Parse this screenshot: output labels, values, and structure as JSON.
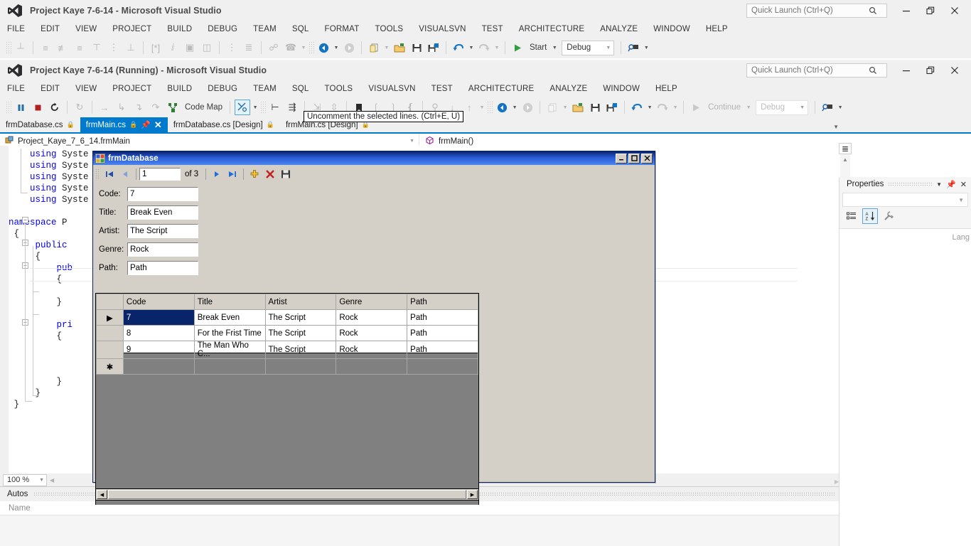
{
  "outer_window": {
    "title": "Project Kaye 7-6-14 - Microsoft Visual Studio",
    "logo_icon": "visual-studio-logo-icon",
    "quick_launch": {
      "placeholder": "Quick Launch (Ctrl+Q)",
      "value": "",
      "icon": "search-icon"
    },
    "window_buttons": {
      "minimize": "—",
      "restore": "❐",
      "close": "✕"
    },
    "menu": [
      "FILE",
      "EDIT",
      "VIEW",
      "PROJECT",
      "BUILD",
      "DEBUG",
      "TEAM",
      "SQL",
      "FORMAT",
      "TOOLS",
      "VISUALSVN",
      "TEST",
      "ARCHITECTURE",
      "ANALYZE",
      "WINDOW",
      "HELP"
    ],
    "toolbar": {
      "start_label": "Start",
      "config_value": "Debug",
      "icons": [
        "align-to-grid-icon",
        "align-lefts-icon",
        "align-centers-icon",
        "align-rights-icon",
        "align-tops-icon",
        "align-middles-icon",
        "align-bottoms-icon",
        "make-same-width-icon",
        "make-same-height-icon",
        "make-same-size-icon",
        "size-to-grid-icon",
        "horizontal-spacing-icon",
        "vertical-spacing-icon",
        "bring-to-front-icon",
        "send-to-back-icon",
        "navigate-backward-icon",
        "navigate-forward-icon",
        "new-project-icon",
        "open-file-icon",
        "save-icon",
        "save-all-icon",
        "undo-icon",
        "redo-icon",
        "start-debug-icon",
        "attach-icon"
      ]
    }
  },
  "running_window": {
    "title": "Project Kaye 7-6-14 (Running) - Microsoft Visual Studio",
    "logo_icon": "visual-studio-logo-icon",
    "quick_launch": {
      "placeholder": "Quick Launch (Ctrl+Q)",
      "value": "",
      "icon": "search-icon"
    },
    "window_buttons": {
      "minimize": "—",
      "restore": "❐",
      "close": "✕"
    },
    "menu": [
      "FILE",
      "EDIT",
      "VIEW",
      "PROJECT",
      "BUILD",
      "DEBUG",
      "TEAM",
      "SQL",
      "TOOLS",
      "VISUALSVN",
      "TEST",
      "ARCHITECTURE",
      "ANALYZE",
      "WINDOW",
      "HELP"
    ],
    "toolbar": {
      "code_map_label": "Code Map",
      "continue_label": "Continue",
      "config_value": "Debug",
      "icons": [
        "pause-icon",
        "stop-icon",
        "restart-icon",
        "refresh-windows-app-icon",
        "step-over-icon",
        "step-into-icon",
        "step-out-icon",
        "step-cycle-icon",
        "code-map-icon",
        "uncomment-icon",
        "increase-indent-icon",
        "comment-block-icon",
        "collapse-icon",
        "expand-icon",
        "bookmark-icon",
        "prev-bookmark-icon",
        "next-bookmark-icon",
        "clear-bookmarks-icon",
        "find-icon",
        "find-next-icon",
        "find-prev-icon",
        "navigate-backward-icon",
        "navigate-forward-icon",
        "new-project-icon",
        "open-file-icon",
        "save-icon",
        "save-all-icon",
        "undo-icon",
        "redo-icon",
        "continue-icon",
        "attach-icon"
      ]
    },
    "tooltip": "Uncomment the selected lines. (Ctrl+E, U)"
  },
  "tabs": [
    {
      "label": "frmDatabase.cs",
      "active": false,
      "lock_icon": "lock-icon"
    },
    {
      "label": "frmMain.cs",
      "active": true,
      "lock_icon": "lock-icon",
      "pin_icon": "pin-icon",
      "close_icon": "close-icon"
    },
    {
      "label": "frmDatabase.cs [Design]",
      "active": false,
      "lock_icon": "lock-icon"
    },
    {
      "label": "frmMain.cs [Design]",
      "active": false,
      "lock_icon": "lock-icon"
    }
  ],
  "nav_bar": {
    "type_icon": "class-icon",
    "type": "Project_Kaye_7_6_14.frmMain",
    "member_icon": "method-icon",
    "member": "frmMain()"
  },
  "code": {
    "lines": [
      {
        "indent": 4,
        "text": "using System",
        "kw": "using"
      },
      {
        "indent": 4,
        "text": "using System",
        "kw": "using"
      },
      {
        "indent": 4,
        "text": "using System",
        "kw": "using"
      },
      {
        "indent": 4,
        "text": "using System",
        "kw": "using"
      },
      {
        "indent": 4,
        "text": "using System",
        "kw": "using"
      },
      {
        "indent": 0,
        "text": ""
      },
      {
        "indent": 0,
        "text": "namespace P",
        "kw": "namespace"
      },
      {
        "indent": 1,
        "text": "{"
      },
      {
        "indent": 4,
        "text": "public",
        "kw": "public"
      },
      {
        "indent": 4,
        "text": "{"
      },
      {
        "indent": 8,
        "text": "pub",
        "kw": "pub"
      },
      {
        "indent": 8,
        "text": "{"
      },
      {
        "indent": 0,
        "text": ""
      },
      {
        "indent": 8,
        "text": "}"
      },
      {
        "indent": 0,
        "text": ""
      },
      {
        "indent": 8,
        "text": "pri",
        "kw": "pri"
      },
      {
        "indent": 8,
        "text": "{"
      },
      {
        "indent": 0,
        "text": ""
      },
      {
        "indent": 0,
        "text": ""
      },
      {
        "indent": 0,
        "text": ""
      },
      {
        "indent": 8,
        "text": "}"
      },
      {
        "indent": 4,
        "text": "}"
      },
      {
        "indent": 0,
        "text": "}"
      }
    ]
  },
  "editor_status": {
    "zoom": "100 %"
  },
  "autos_panel": {
    "title": "Autos",
    "columns": [
      "Name",
      "Lang"
    ],
    "dropdown_icon": "chevron-down-icon",
    "pin_icon": "pin-icon",
    "close_icon": "close-icon"
  },
  "properties_panel": {
    "title": "Properties",
    "dropdown_icon": "chevron-down-icon",
    "pin_icon": "pin-icon",
    "close_icon": "close-icon",
    "toolbar_icons": [
      "categorized-icon",
      "alphabetical-icon",
      "properties-page-icon"
    ]
  },
  "frm_database": {
    "title": "frmDatabase",
    "icon": "windows-form-icon",
    "window_buttons": {
      "minimize": "_",
      "maximize": "□",
      "close": "✕"
    },
    "binding_nav": {
      "first_icon": "move-first-icon",
      "prev_icon": "move-previous-icon",
      "position": "1",
      "count_label": "of 3",
      "next_icon": "move-next-icon",
      "last_icon": "move-last-icon",
      "add_icon": "add-new-icon",
      "delete_icon": "delete-icon",
      "save_icon": "save-icon"
    },
    "fields": [
      {
        "label": "Code:",
        "value": "7"
      },
      {
        "label": "Title:",
        "value": "Break Even"
      },
      {
        "label": "Artist:",
        "value": "The Script"
      },
      {
        "label": "Genre:",
        "value": "Rock"
      },
      {
        "label": "Path:",
        "value": "Path"
      }
    ],
    "grid": {
      "columns": [
        "Code",
        "Title",
        "Artist",
        "Genre",
        "Path"
      ],
      "rows": [
        {
          "marker": "▶",
          "selected_cell": 0,
          "cells": [
            "7",
            "Break Even",
            "The Script",
            "Rock",
            "Path"
          ]
        },
        {
          "marker": "",
          "selected_cell": -1,
          "cells": [
            "8",
            "For the Frist Time",
            "The Script",
            "Rock",
            "Path"
          ]
        },
        {
          "marker": "",
          "selected_cell": -1,
          "cells": [
            "9",
            "The Man Who C...",
            "The Script",
            "Rock",
            "Path"
          ]
        },
        {
          "marker": "✱",
          "selected_cell": -1,
          "cells": [
            "",
            "",
            "",
            "",
            ""
          ]
        }
      ],
      "hscroll": {
        "left_icon": "scroll-left-icon",
        "right_icon": "scroll-right-icon"
      }
    }
  },
  "colors": {
    "vs_blue": "#007acc",
    "chrome": "#f0f0f0",
    "winform_face": "#d4d0c8",
    "winform_title_start": "#0a246a",
    "grid_selection": "#08246b",
    "grid_empty_back": "#808080",
    "code_keyword": "#0000ff"
  }
}
